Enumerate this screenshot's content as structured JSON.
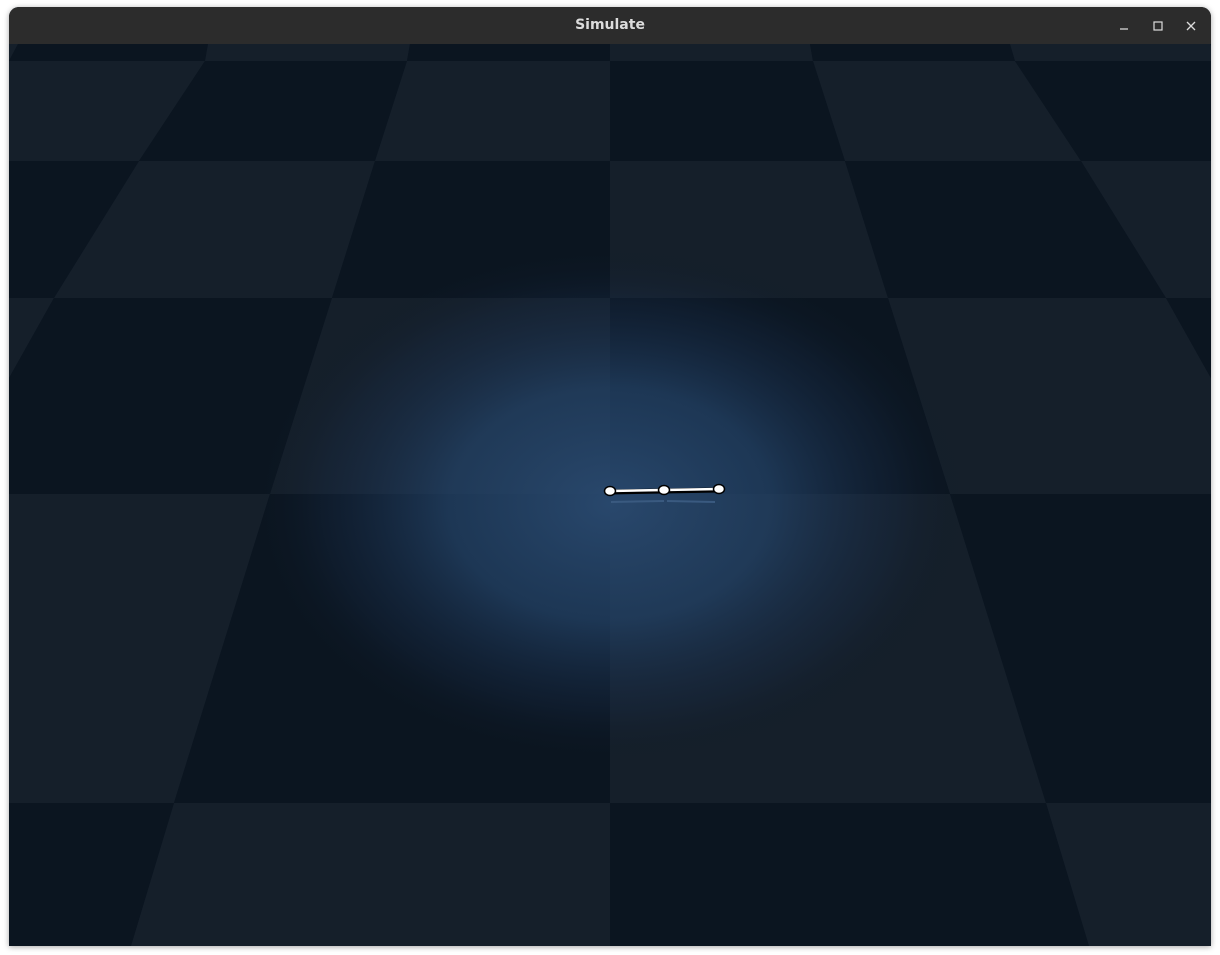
{
  "window": {
    "title": "Simulate",
    "controls": {
      "minimize_icon": "minimize-icon",
      "maximize_icon": "maximize-icon",
      "close_icon": "close-icon"
    }
  },
  "scene": {
    "floor": {
      "pattern": "checkerboard",
      "dark_color": "#0b1520",
      "light_color": "#151f2a",
      "light_glow_color": "#4a6a90"
    },
    "model": {
      "segments": 2,
      "joints": 3,
      "body_color": "#ffffff",
      "outline_color": "#000000"
    }
  }
}
